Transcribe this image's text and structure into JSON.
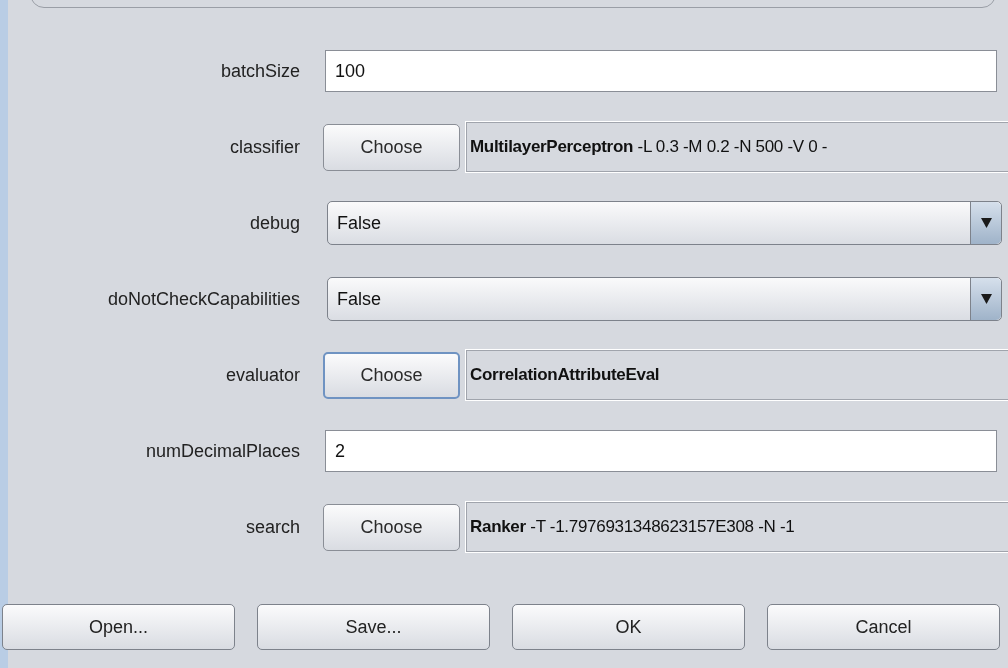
{
  "properties": [
    {
      "kind": "text",
      "label": "batchSize",
      "value": "100"
    },
    {
      "kind": "chooser",
      "label": "classifier",
      "button": "Choose",
      "name": "MultilayerPerceptron",
      "options": "-L 0.3 -M 0.2 -N 500 -V 0 -",
      "focused": false
    },
    {
      "kind": "dropdown",
      "label": "debug",
      "value": "False"
    },
    {
      "kind": "dropdown",
      "label": "doNotCheckCapabilities",
      "value": "False"
    },
    {
      "kind": "chooser",
      "label": "evaluator",
      "button": "Choose",
      "name": "CorrelationAttributeEval",
      "focused": true
    },
    {
      "kind": "text",
      "label": "numDecimalPlaces",
      "value": "2"
    },
    {
      "kind": "chooser",
      "label": "search",
      "button": "Choose",
      "name": "Ranker",
      "options": "-T -1.7976931348623157E308 -N -1",
      "focused": false
    }
  ],
  "buttons": [
    "Open...",
    "Save...",
    "OK",
    "Cancel"
  ]
}
